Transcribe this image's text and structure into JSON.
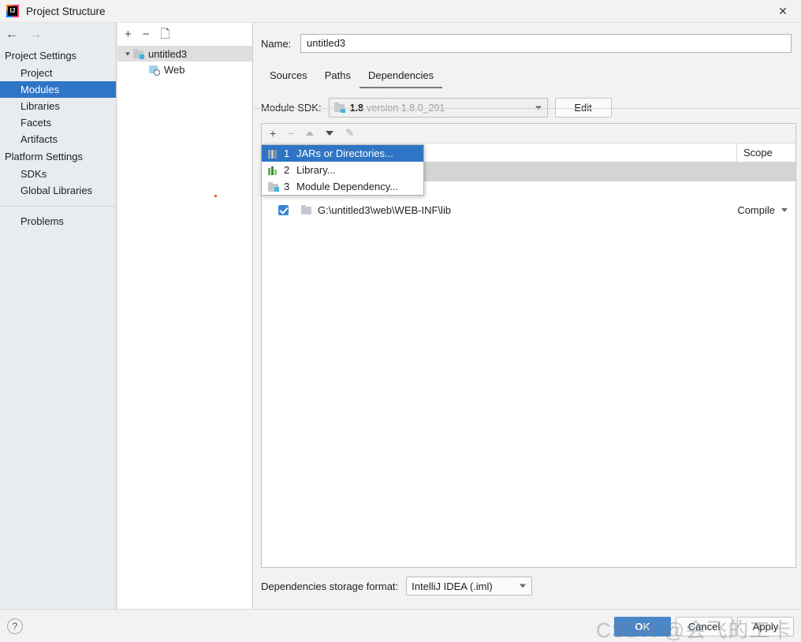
{
  "window": {
    "title": "Project Structure",
    "logo_letters": "IJ",
    "close_icon": "close-icon"
  },
  "nav": {
    "back_icon": "←",
    "forward_icon": "→"
  },
  "sidebar": {
    "groups": [
      {
        "title": "Project Settings",
        "items": [
          {
            "label": "Project",
            "selected": false
          },
          {
            "label": "Modules",
            "selected": true
          },
          {
            "label": "Libraries",
            "selected": false
          },
          {
            "label": "Facets",
            "selected": false
          },
          {
            "label": "Artifacts",
            "selected": false
          }
        ]
      },
      {
        "title": "Platform Settings",
        "items": [
          {
            "label": "SDKs",
            "selected": false
          },
          {
            "label": "Global Libraries",
            "selected": false
          }
        ]
      }
    ],
    "problems_label": "Problems"
  },
  "tree": {
    "toolbar": [
      {
        "name": "add-module-button",
        "glyph": "+"
      },
      {
        "name": "remove-module-button",
        "glyph": "−"
      },
      {
        "name": "copy-module-button",
        "glyph": "❐"
      }
    ],
    "nodes": [
      {
        "label": "untitled3",
        "icon": "module-icon",
        "expanded": true,
        "selected": true
      },
      {
        "label": "Web",
        "icon": "web-facet-icon",
        "expanded": false,
        "selected": false
      }
    ]
  },
  "module": {
    "name_label": "Name:",
    "name_value": "untitled3",
    "tabs": [
      {
        "label": "Sources",
        "active": false
      },
      {
        "label": "Paths",
        "active": false
      },
      {
        "label": "Dependencies",
        "active": true
      }
    ],
    "sdk_label": "Module SDK:",
    "sdk_value": "1.8",
    "sdk_version": "version 1.8.0_291",
    "edit_button": "Edit"
  },
  "dependencies": {
    "toolbar": [
      {
        "name": "add-dependency-button",
        "glyph": "+"
      },
      {
        "name": "remove-dependency-button",
        "glyph": "−"
      },
      {
        "name": "move-up-button",
        "glyph": "▲"
      },
      {
        "name": "move-down-button",
        "glyph": "▼"
      },
      {
        "name": "edit-dependency-button",
        "glyph": "✎"
      }
    ],
    "columns": {
      "export": "",
      "scope": "Scope"
    },
    "rows": [
      {
        "checked": true,
        "label": "G:\\untitled3\\web\\WEB-INF\\lib",
        "scope": "Compile",
        "icon": "folder-icon"
      }
    ]
  },
  "add_menu": {
    "items": [
      {
        "number": "1",
        "label": "JARs or Directories...",
        "icon": "jars-icon",
        "selected": true
      },
      {
        "number": "2",
        "label": "Library...",
        "icon": "library-icon",
        "selected": false
      },
      {
        "number": "3",
        "label": "Module Dependency...",
        "icon": "module-dependency-icon",
        "selected": false
      }
    ]
  },
  "storage": {
    "label": "Dependencies storage format:",
    "value": "IntelliJ IDEA (.iml)"
  },
  "footer": {
    "help": "?",
    "ok": "OK",
    "cancel": "Cancel",
    "apply": "Apply"
  },
  "watermark": {
    "text": "CSDN @会飞的工卡"
  },
  "colors": {
    "accent": "#2f75c5",
    "primary_button": "#4a86c8",
    "selection_grey": "#d4d4d4",
    "sidebar_bg": "#e8ecf0",
    "marker_orange": "#e8633a"
  }
}
